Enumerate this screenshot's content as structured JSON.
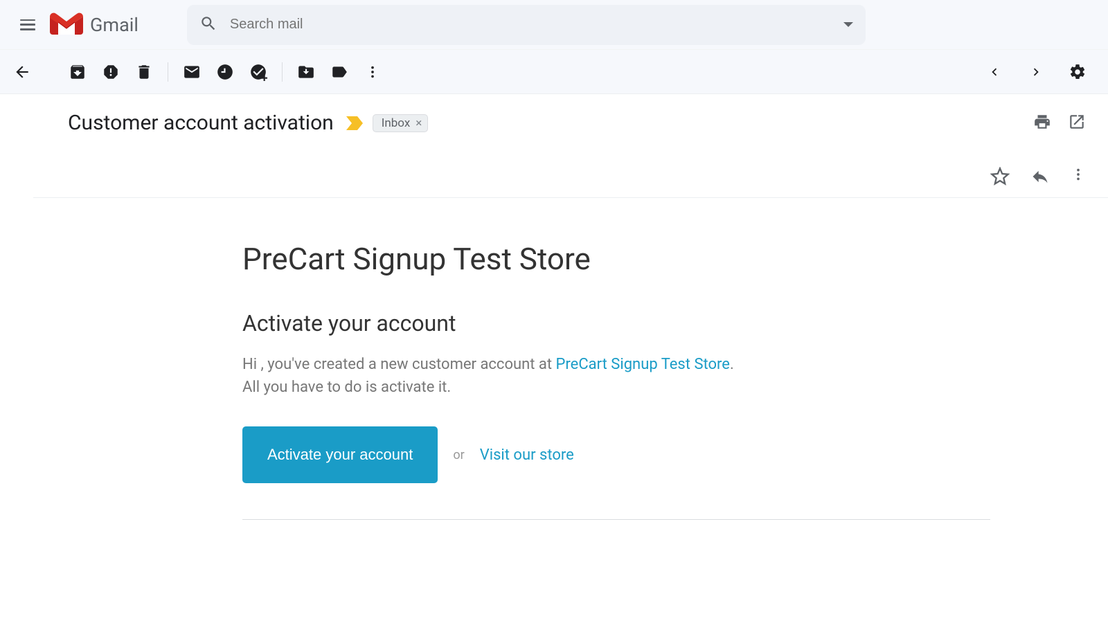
{
  "header": {
    "brand": "Gmail",
    "search_placeholder": "Search mail"
  },
  "subject": {
    "text": "Customer account activation",
    "label": "Inbox"
  },
  "email": {
    "store_name": "PreCart Signup Test Store",
    "heading": "Activate your account",
    "greeting_prefix": "Hi , you've created a new customer account at ",
    "store_link_text": "PreCart Signup Test Store",
    "greeting_suffix": ". All you have to do is activate it.",
    "cta_label": "Activate your account",
    "or_text": "or",
    "visit_link": "Visit our store"
  }
}
